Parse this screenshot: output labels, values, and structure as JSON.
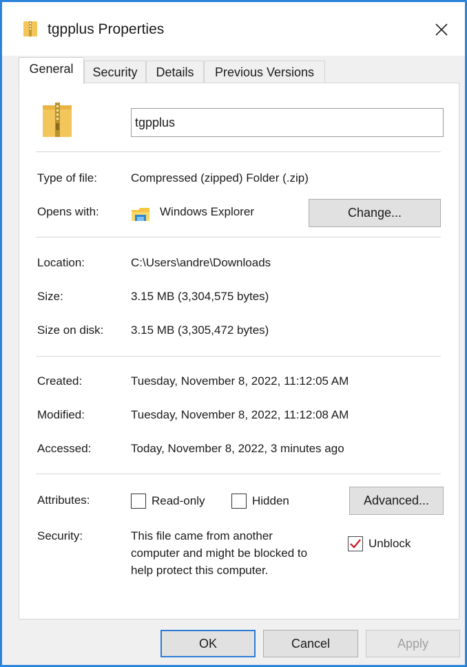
{
  "window": {
    "title": "tgpplus Properties",
    "icon": "zip-folder-icon",
    "close_icon": "close-icon"
  },
  "tabs": [
    {
      "label": "General",
      "active": true
    },
    {
      "label": "Security",
      "active": false
    },
    {
      "label": "Details",
      "active": false
    },
    {
      "label": "Previous Versions",
      "active": false
    }
  ],
  "general": {
    "file_name": "tgpplus",
    "type_label": "Type of file:",
    "type_value": "Compressed (zipped) Folder (.zip)",
    "opens_label": "Opens with:",
    "opens_value": "Windows Explorer",
    "change_button": "Change...",
    "location_label": "Location:",
    "location_value": "C:\\Users\\andre\\Downloads",
    "size_label": "Size:",
    "size_value": "3.15 MB (3,304,575 bytes)",
    "size_disk_label": "Size on disk:",
    "size_disk_value": "3.15 MB (3,305,472 bytes)",
    "created_label": "Created:",
    "created_value": "Tuesday, November 8, 2022, 11:12:05 AM",
    "modified_label": "Modified:",
    "modified_value": "Tuesday, November 8, 2022, 11:12:08 AM",
    "accessed_label": "Accessed:",
    "accessed_value": "Today, November 8, 2022, 3 minutes ago",
    "attributes_label": "Attributes:",
    "readonly_label": "Read-only",
    "readonly_checked": false,
    "hidden_label": "Hidden",
    "hidden_checked": false,
    "advanced_button": "Advanced...",
    "security_label": "Security:",
    "security_line1": "This file came from another",
    "security_line2": "computer and might be blocked to",
    "security_line3": "help protect this computer.",
    "unblock_label": "Unblock",
    "unblock_checked": true
  },
  "footer": {
    "ok": "OK",
    "cancel": "Cancel",
    "apply": "Apply"
  },
  "colors": {
    "accent_border": "#2b82d9",
    "check_mark": "#d0121b",
    "folder": "#f3c65b",
    "disabled_text": "#a0a0a0"
  }
}
